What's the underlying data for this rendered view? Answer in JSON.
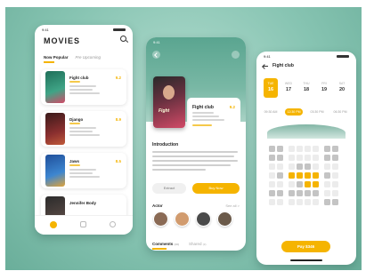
{
  "status_time": "9:41",
  "list_screen": {
    "title": "MOVIES",
    "tabs": [
      "Now Popular",
      "Pre Upcoming"
    ],
    "movies": [
      {
        "title": "Fight club",
        "rating": "9.2",
        "poster_color": "#2f8a70"
      },
      {
        "title": "Django",
        "rating": "8.9",
        "poster_color": "#7a2c2c"
      },
      {
        "title": "Jaws",
        "rating": "8.5",
        "poster_color": "#2a6db5"
      },
      {
        "title": "Jennifer Body",
        "rating": "",
        "poster_color": "#3b3b3b"
      }
    ]
  },
  "detail_screen": {
    "movie_title": "Fight club",
    "rating": "9.2",
    "poster_text": "Fight",
    "intro_heading": "Introduction",
    "watch_button": "Extract",
    "buy_button": "Buy Now",
    "actor_heading": "Actor",
    "see_all": "See all >",
    "actor_colors": [
      "#8a6a55",
      "#d19b6e",
      "#4a4a4a",
      "#6b5a4a"
    ],
    "comments_tab": "Comments",
    "comments_count": "(16)",
    "shared_tab": "Shared",
    "shared_count": "(3)"
  },
  "booking_screen": {
    "title": "Fight club",
    "dates": [
      {
        "day": "TUE",
        "num": "16",
        "selected": true
      },
      {
        "day": "WED",
        "num": "17",
        "selected": false
      },
      {
        "day": "THU",
        "num": "18",
        "selected": false
      },
      {
        "day": "FRI",
        "num": "19",
        "selected": false
      },
      {
        "day": "SAT",
        "num": "20",
        "selected": false
      }
    ],
    "times": [
      {
        "label": "09:30 AM",
        "selected": false
      },
      {
        "label": "12:30 PM",
        "selected": true
      },
      {
        "label": "03:30 PM",
        "selected": false
      },
      {
        "label": "06:30 PM",
        "selected": false
      }
    ],
    "pay_button": "Pay $346"
  },
  "colors": {
    "accent": "#f5b400",
    "background": "#87c4b2"
  }
}
